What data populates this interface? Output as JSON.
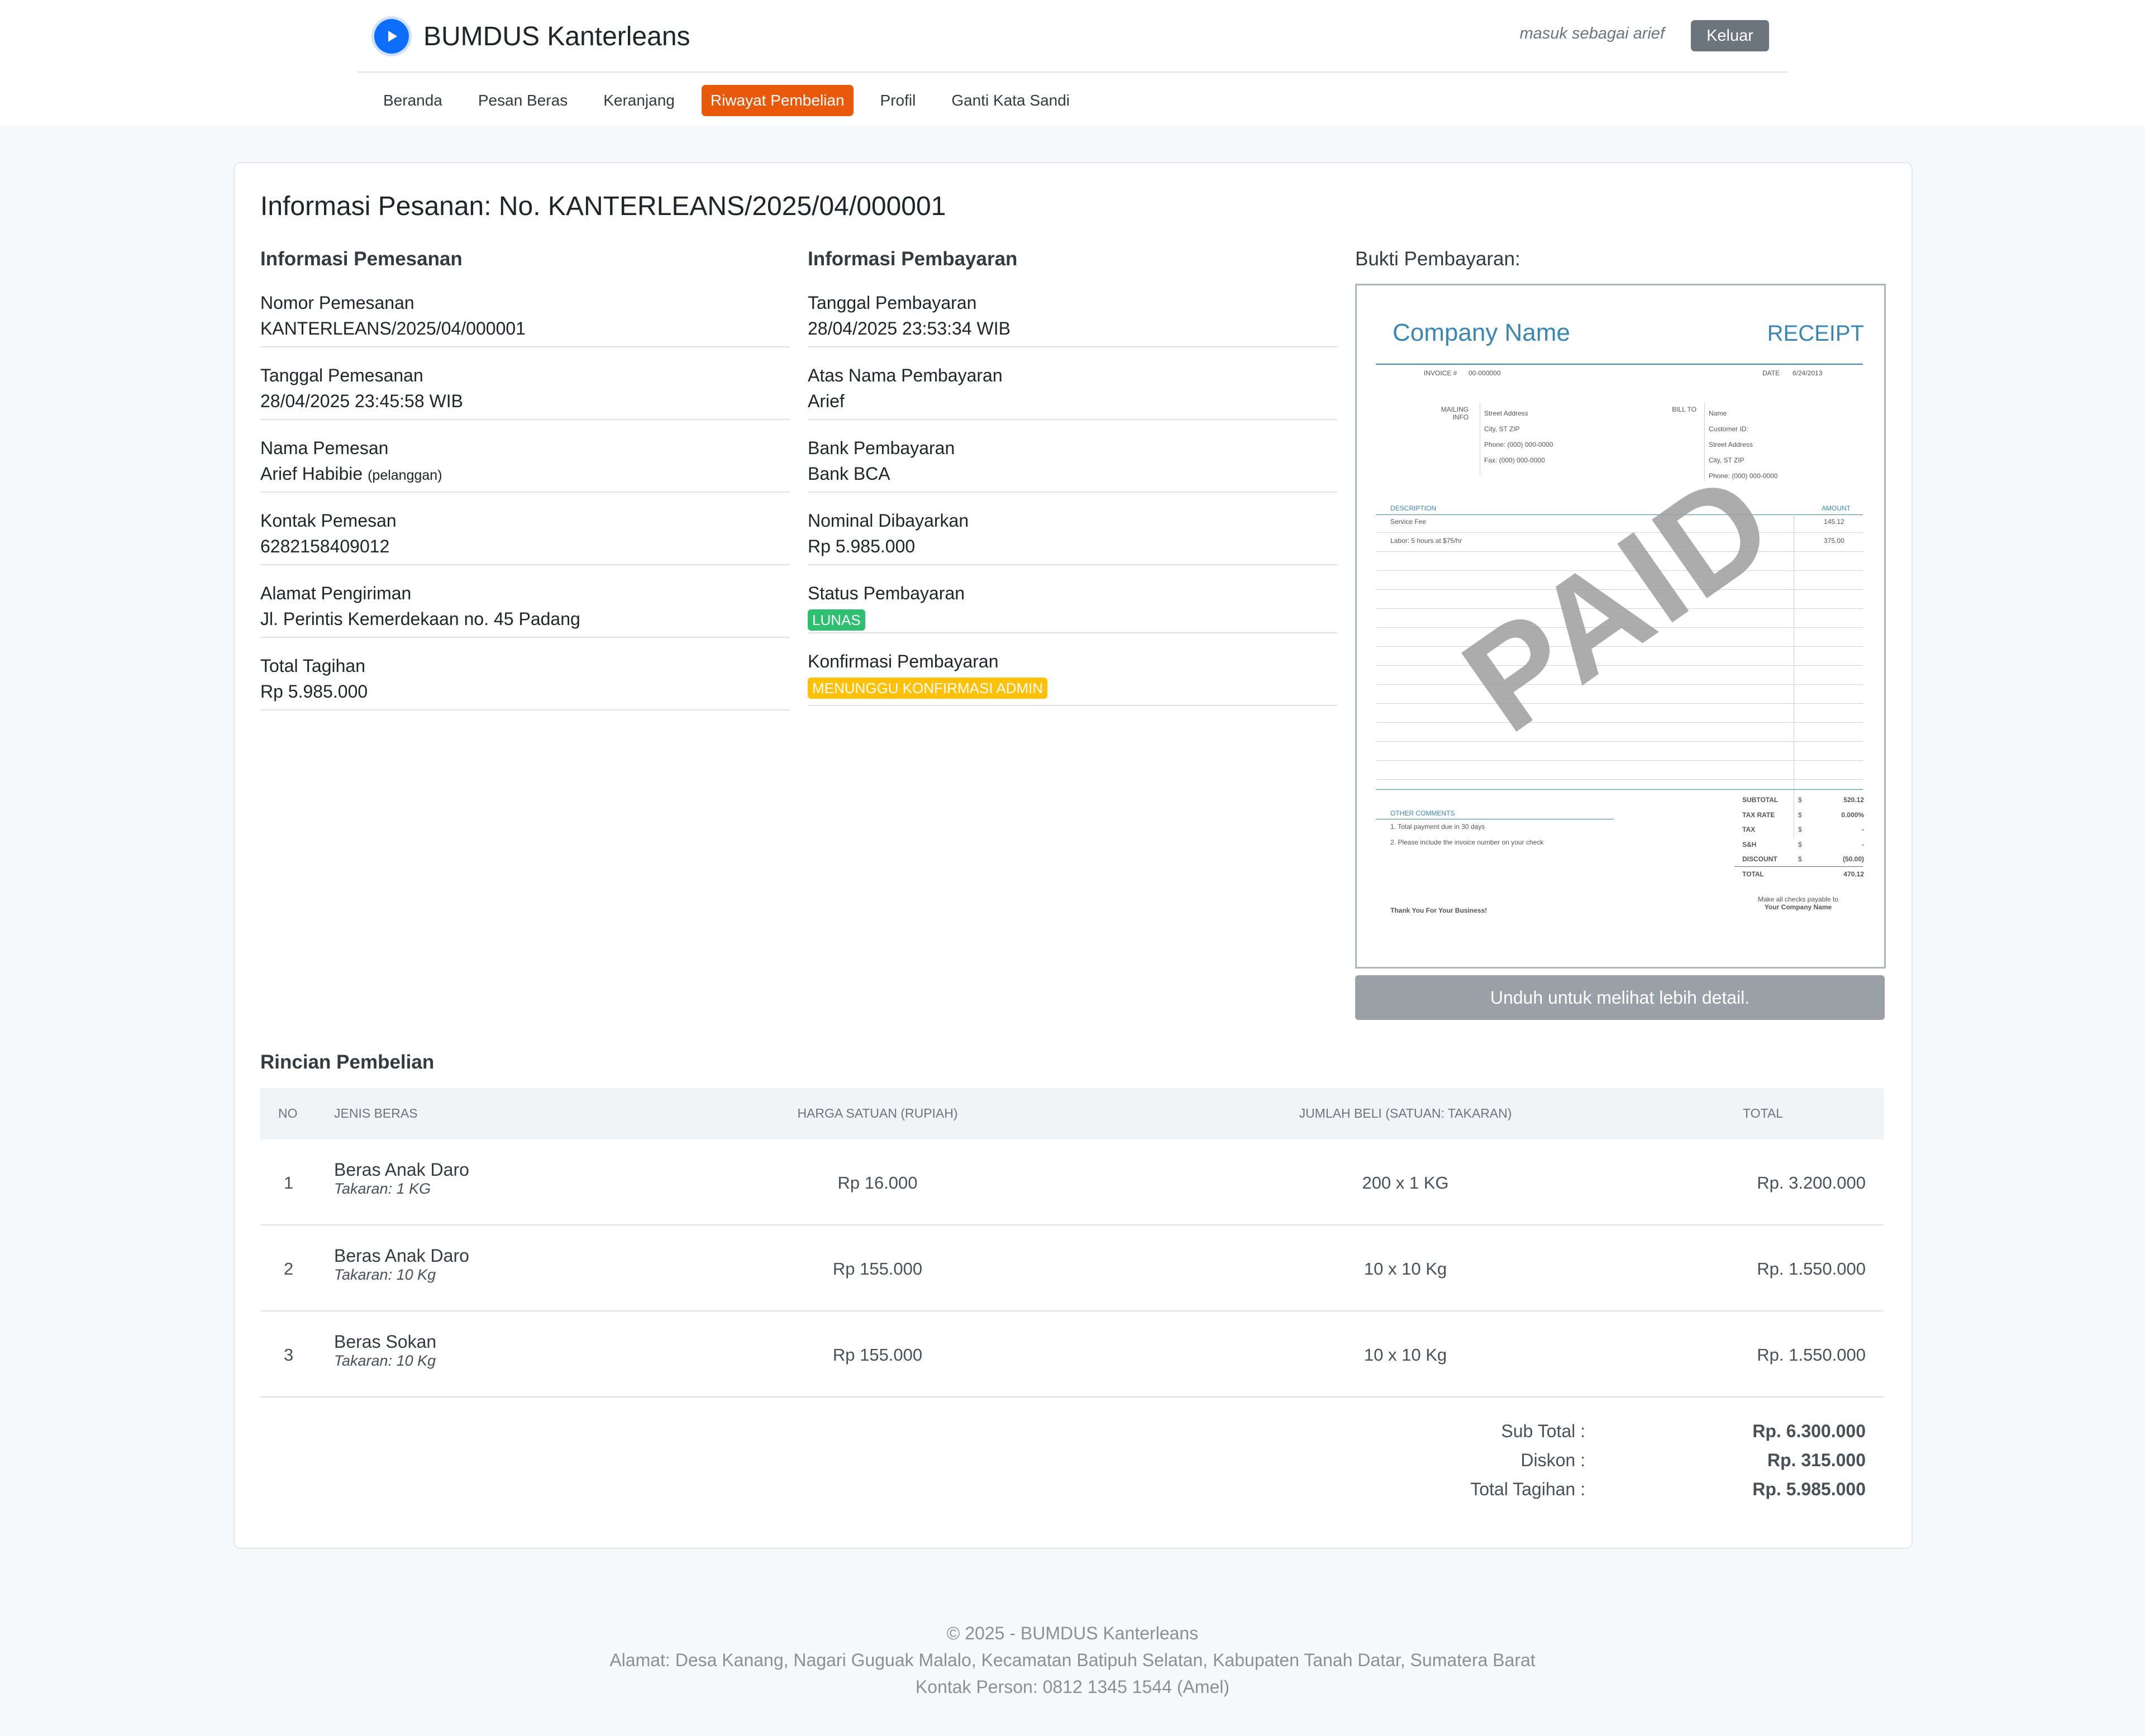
{
  "header": {
    "brand": "BUMDUS Kanterleans",
    "logged_in_as": "masuk sebagai arief",
    "logout_label": "Keluar"
  },
  "nav": [
    {
      "label": "Beranda",
      "active": false
    },
    {
      "label": "Pesan Beras",
      "active": false
    },
    {
      "label": "Keranjang",
      "active": false
    },
    {
      "label": "Riwayat Pembelian",
      "active": true
    },
    {
      "label": "Profil",
      "active": false
    },
    {
      "label": "Ganti Kata Sandi",
      "active": false
    }
  ],
  "page_title": "Informasi Pesanan: No. KANTERLEANS/2025/04/000001",
  "order_info": {
    "title": "Informasi Pemesanan",
    "fields": [
      {
        "label": "Nomor Pemesanan",
        "value": "KANTERLEANS/2025/04/000001"
      },
      {
        "label": "Tanggal Pemesanan",
        "value": "28/04/2025 23:45:58 WIB"
      },
      {
        "label": "Nama Pemesan",
        "value": "Arief Habibie",
        "note": "(pelanggan)"
      },
      {
        "label": "Kontak Pemesan",
        "value": "6282158409012"
      },
      {
        "label": "Alamat Pengiriman",
        "value": "Jl. Perintis Kemerdekaan no. 45 Padang"
      },
      {
        "label": "Total Tagihan",
        "value": "Rp 5.985.000"
      }
    ]
  },
  "payment_info": {
    "title": "Informasi Pembayaran",
    "fields": [
      {
        "label": "Tanggal Pembayaran",
        "value": "28/04/2025 23:53:34 WIB"
      },
      {
        "label": "Atas Nama Pembayaran",
        "value": "Arief"
      },
      {
        "label": "Bank Pembayaran",
        "value": "Bank BCA"
      },
      {
        "label": "Nominal Dibayarkan",
        "value": "Rp 5.985.000"
      },
      {
        "label": "Status Pembayaran",
        "badge": "LUNAS",
        "badge_color": "#2fbf71"
      },
      {
        "label": "Konfirmasi Pembayaran",
        "badge": "MENUNGGU KONFIRMASI ADMIN",
        "badge_color": "#ffc107"
      }
    ]
  },
  "proof": {
    "title": "Bukti Pembayaran:",
    "download_label": "Unduh untuk melihat lebih detail.",
    "receipt": {
      "company": "Company Name",
      "receipt_title": "RECEIPT",
      "invoice_label": "INVOICE #",
      "invoice_no": "00-000000",
      "date_label": "DATE",
      "date": "6/24/2013",
      "mailing_label": "MAILING INFO",
      "mailing_lines": [
        "Street Address",
        "City, ST ZIP",
        "Phone: (000) 000-0000",
        "Fax: (000) 000-0000"
      ],
      "bill_label": "BILL TO",
      "bill_lines": [
        "Name",
        "Customer ID:",
        "Street Address",
        "City, ST ZIP",
        "Phone: (000) 000-0000"
      ],
      "desc_header": "DESCRIPTION",
      "amount_header": "AMOUNT",
      "items": [
        {
          "desc": "Service Fee",
          "amount": "145.12"
        },
        {
          "desc": "Labor: 5 hours at $75/hr",
          "amount": "375.00"
        }
      ],
      "stamp": "PAID",
      "comments_title": "OTHER COMMENTS",
      "comments": [
        "1. Total payment due in 30 days",
        "2. Please include the invoice number on your check"
      ],
      "totals": [
        {
          "label": "SUBTOTAL",
          "cur": "$",
          "value": "520.12"
        },
        {
          "label": "TAX RATE",
          "cur": "",
          "value": "0.000%"
        },
        {
          "label": "TAX",
          "cur": "$",
          "value": "-"
        },
        {
          "label": "S&H",
          "cur": "$",
          "value": "-"
        },
        {
          "label": "DISCOUNT",
          "cur": "$",
          "value": "(50.00)"
        },
        {
          "label": "TOTAL",
          "cur": "$",
          "value": "470.12"
        }
      ],
      "thanks": "Thank You For Your Business!",
      "payable_line1": "Make all checks payable to",
      "payable_line2": "Your Company Name"
    }
  },
  "purchase": {
    "title": "Rincian Pembelian",
    "columns": [
      "NO",
      "JENIS BERAS",
      "HARGA SATUAN (RUPIAH)",
      "JUMLAH BELI (SATUAN: TAKARAN)",
      "TOTAL"
    ],
    "rows": [
      {
        "no": "1",
        "name": "Beras Anak Daro",
        "size": "Takaran: 1 KG",
        "price": "Rp 16.000",
        "qty": "200 x 1 KG",
        "total": "Rp. 3.200.000"
      },
      {
        "no": "2",
        "name": "Beras Anak Daro",
        "size": "Takaran: 10 Kg",
        "price": "Rp 155.000",
        "qty": "10 x 10 Kg",
        "total": "Rp. 1.550.000"
      },
      {
        "no": "3",
        "name": "Beras Sokan",
        "size": "Takaran: 10 Kg",
        "price": "Rp 155.000",
        "qty": "10 x 10 Kg",
        "total": "Rp. 1.550.000"
      }
    ],
    "summary": [
      {
        "label": "Sub Total :",
        "value": "Rp. 6.300.000"
      },
      {
        "label": "Diskon :",
        "value": "Rp. 315.000"
      },
      {
        "label": "Total Tagihan :",
        "value": "Rp. 5.985.000"
      }
    ]
  },
  "footer": {
    "copyright": "© 2025 - BUMDUS Kanterleans",
    "address": "Alamat: Desa Kanang, Nagari Guguak Malalo, Kecamatan Batipuh Selatan, Kabupaten Tanah Datar, Sumatera Barat",
    "contact": "Kontak Person: 0812 1345 1544 (Amel)"
  },
  "colors": {
    "accent": "#e8590c",
    "brand_blue": "#0d6efd",
    "success": "#2fbf71",
    "warning": "#ffc107",
    "secondary": "#6c757d"
  }
}
